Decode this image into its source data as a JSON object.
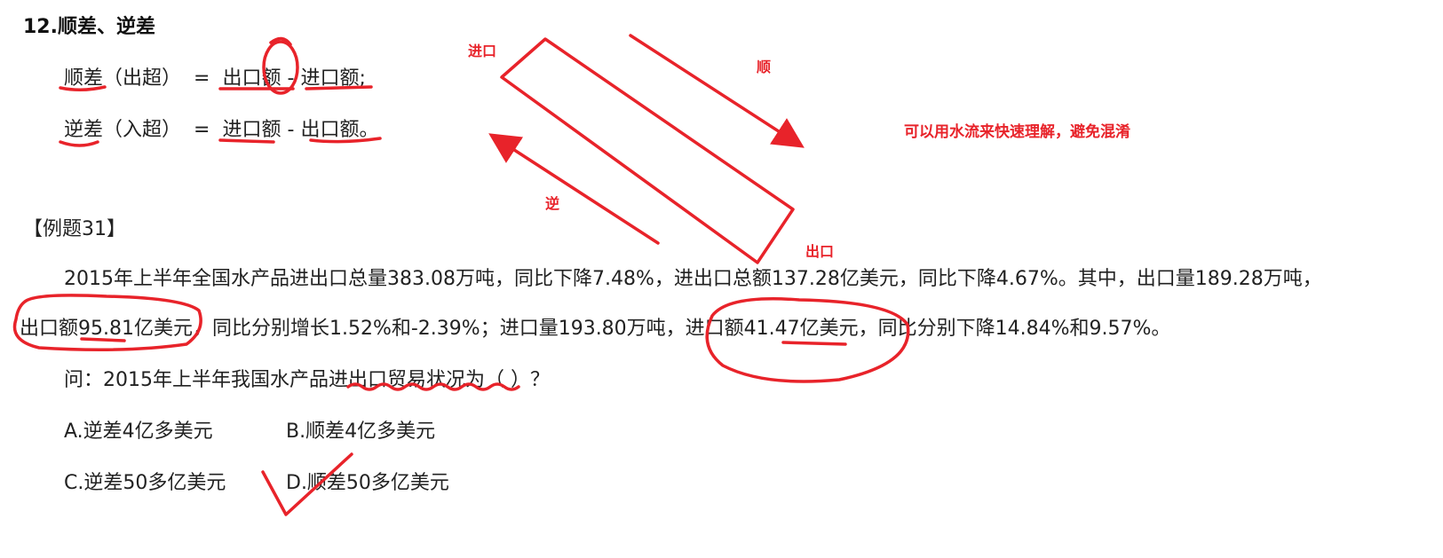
{
  "section_title": "12.顺差、逆差",
  "formulas": {
    "surplus": {
      "term": "顺差",
      "paren": "（出超）",
      "eq": "=",
      "a": "出口额",
      "op": "-",
      "b": "进口额",
      "end": ";"
    },
    "deficit": {
      "term": "逆差",
      "paren": "（入超）",
      "eq": "=",
      "a": "进口额",
      "op": "-",
      "b": "出口额",
      "end": "。"
    }
  },
  "diagram": {
    "label_import": "进口",
    "label_forward": "顺",
    "label_reverse": "逆",
    "label_export": "出口",
    "note": "可以用水流来快速理解，避免混淆"
  },
  "example": {
    "heading": "【例题31】",
    "line1": "2015年上半年全国水产品进出口总量383.08万吨，同比下降7.48%，进出口总额137.28亿美元，同比下降4.67%。其中，出口量189.28万吨，",
    "line2": "出口额95.81亿美元，同比分别增长1.52%和-2.39%；进口量193.80万吨，进口额41.47亿美元，同比分别下降14.84%和9.57%。",
    "question": "问：2015年上半年我国水产品进出口贸易状况为（ ）？",
    "options": {
      "a": "A.逆差4亿多美元",
      "b": "B.顺差4亿多美元",
      "c": "C.逆差50多亿美元",
      "d": "D.顺差50多亿美元"
    }
  },
  "colors": {
    "annotation": "#e8232a",
    "text": "#222222"
  }
}
